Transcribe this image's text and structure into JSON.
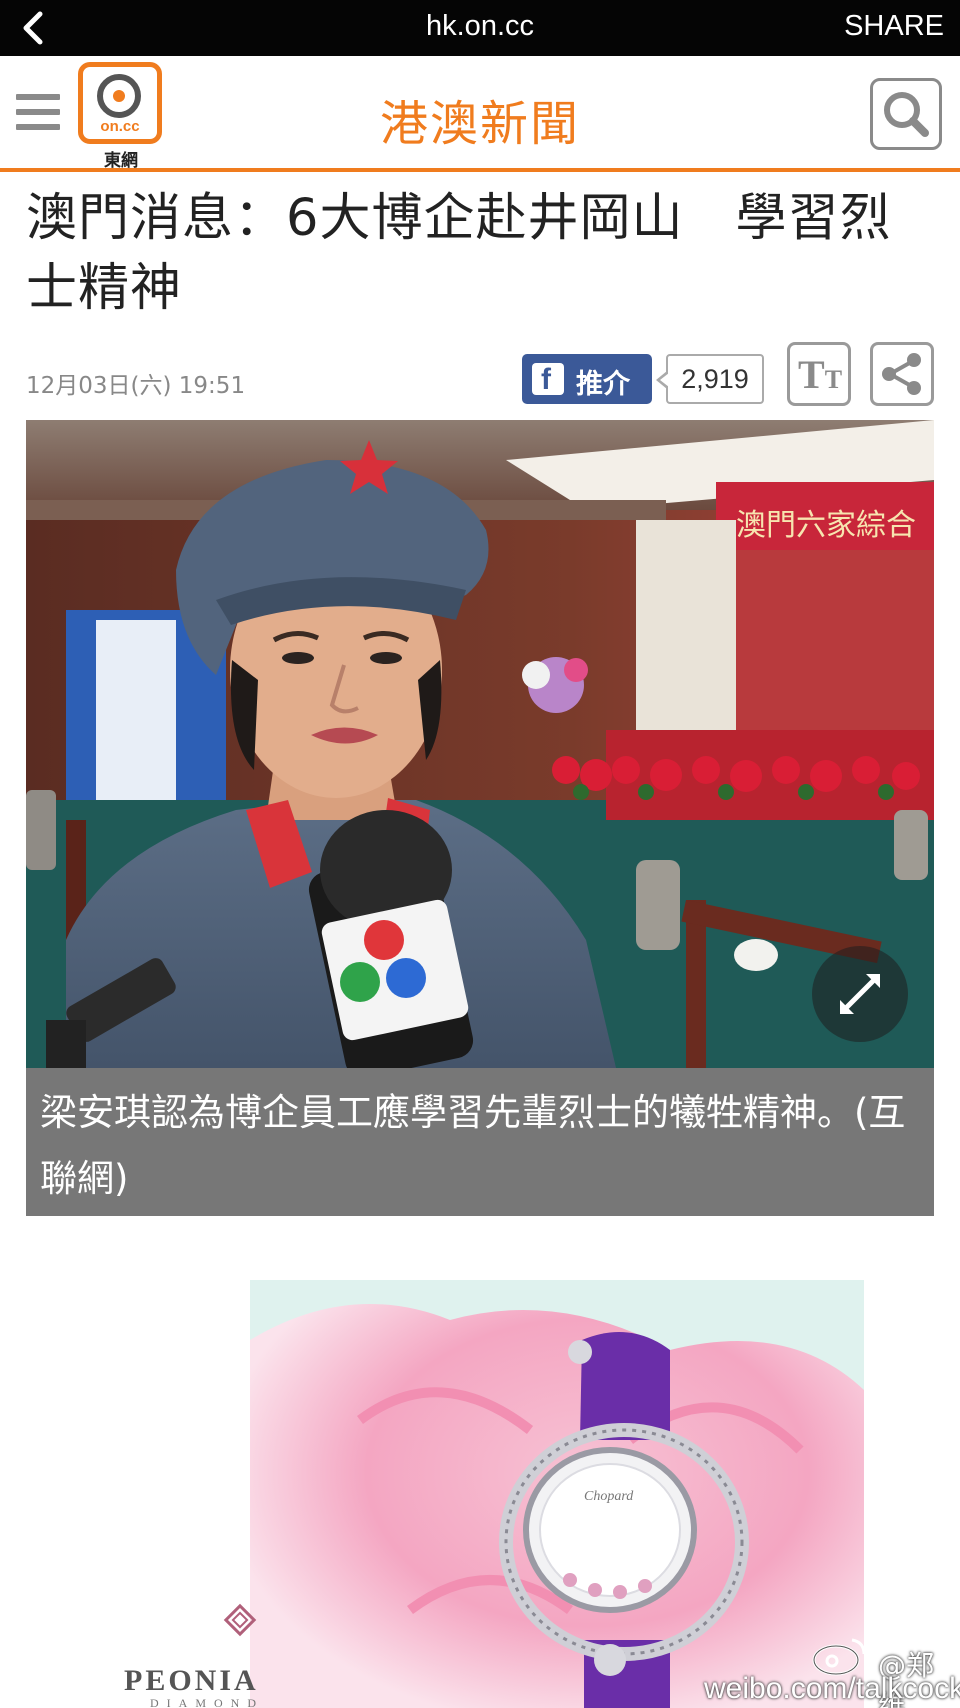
{
  "browser": {
    "url": "hk.on.cc",
    "share_label": "SHARE"
  },
  "header": {
    "logo_text": "on.cc",
    "logo_caption": "東網",
    "section_title": "港澳新聞"
  },
  "article": {
    "headline": "澳門消息：6大博企赴井岡山　學習烈士精神",
    "datetime": "12月03日(六) 19:51",
    "fb_like_label": "推介",
    "fb_like_count": "2,919",
    "photo_caption": "梁安琪認為博企員工應學習先輩烈士的犧牲精神。(互聯網)"
  },
  "ad": {
    "brand": "PEONIA",
    "sub": "DIAMOND"
  },
  "watermark": {
    "user": "@郑维",
    "url": "weibo.com/talkcock"
  },
  "colors": {
    "accent": "#f07c1e",
    "facebook": "#3b5998",
    "caption_bg": "#777777"
  },
  "icons": [
    "back-chevron-icon",
    "hamburger-menu-icon",
    "search-icon",
    "facebook-icon",
    "font-size-icon",
    "share-icon",
    "expand-icon",
    "weibo-icon"
  ]
}
